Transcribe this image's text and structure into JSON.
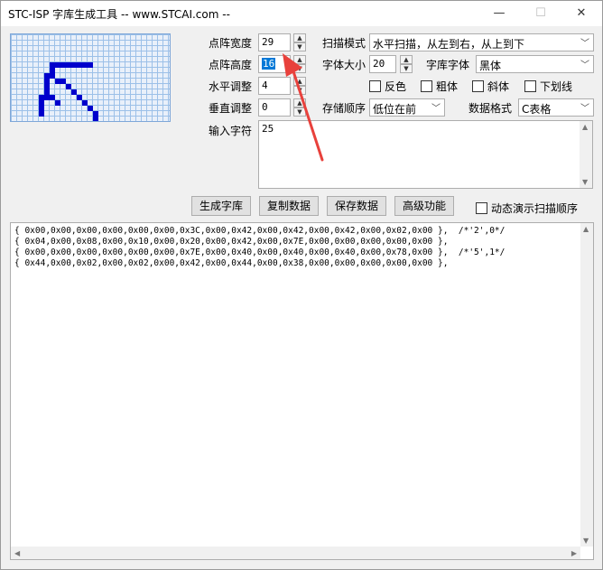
{
  "window": {
    "title": "STC-ISP 字库生成工具 -- www.STCAI.com --",
    "minimize_glyph": "—",
    "maximize_glyph": "☐",
    "close_glyph": "✕"
  },
  "settings": {
    "dot_width_label": "点阵宽度",
    "dot_width_value": "29",
    "dot_height_label": "点阵高度",
    "dot_height_value": "16",
    "h_adjust_label": "水平调整",
    "h_adjust_value": "4",
    "v_adjust_label": "垂直调整",
    "v_adjust_value": "0",
    "input_label": "输入字符",
    "input_value": "25",
    "scan_mode_label": "扫描模式",
    "scan_mode_value": "水平扫描，从左到右，从上到下",
    "font_size_label": "字体大小",
    "font_size_value": "20",
    "font_label": "字库字体",
    "font_value": "黑体",
    "invert_label": "反色",
    "bold_label": "粗体",
    "italic_label": "斜体",
    "underline_label": "下划线",
    "store_order_label": "存储顺序",
    "store_order_value": "低位在前",
    "data_format_label": "数据格式",
    "data_format_value": "C表格"
  },
  "buttons": {
    "generate": "生成字库",
    "copy": "复制数据",
    "save": "保存数据",
    "advanced": "高级功能",
    "dynamic_demo": "动态演示扫描顺序"
  },
  "output": {
    "lines": [
      "{ 0x00,0x00,0x00,0x00,0x00,0x00,0x3C,0x00,0x42,0x00,0x42,0x00,0x42,0x00,0x02,0x00 },  /*'2',0*/",
      "{ 0x04,0x00,0x08,0x00,0x10,0x00,0x20,0x00,0x42,0x00,0x7E,0x00,0x00,0x00,0x00,0x00 },",
      "{ 0x00,0x00,0x00,0x00,0x00,0x00,0x7E,0x00,0x40,0x00,0x40,0x00,0x40,0x00,0x78,0x00 },  /*'5',1*/",
      "{ 0x44,0x00,0x02,0x00,0x02,0x00,0x42,0x00,0x44,0x00,0x38,0x00,0x00,0x00,0x00,0x00 },"
    ]
  },
  "annotation": {
    "color": "#e8413c"
  },
  "colors": {
    "pixel_on": "#0000cc",
    "grid_bg": "#e9f0fa",
    "grid_line": "#9cc0e8"
  }
}
